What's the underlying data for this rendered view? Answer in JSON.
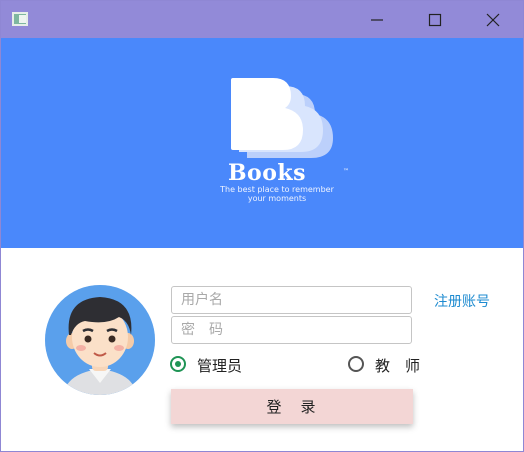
{
  "window": {
    "icon": "app-window-icon",
    "controls": {
      "minimize": "minimize-icon",
      "maximize": "maximize-icon",
      "close": "close-icon"
    }
  },
  "banner": {
    "logo_text": "Books",
    "trademark": "™",
    "tagline_line1": "The best place to remember",
    "tagline_line2": "your moments",
    "background": "#4a88fb"
  },
  "form": {
    "username_placeholder": "用户名",
    "password_placeholder": "密　码",
    "register_link": "注册账号",
    "roles": [
      {
        "label": "管理员",
        "checked": true
      },
      {
        "label": "教　师",
        "checked": false
      }
    ],
    "login_label": "登　录",
    "login_color": "#f3d6d5"
  }
}
